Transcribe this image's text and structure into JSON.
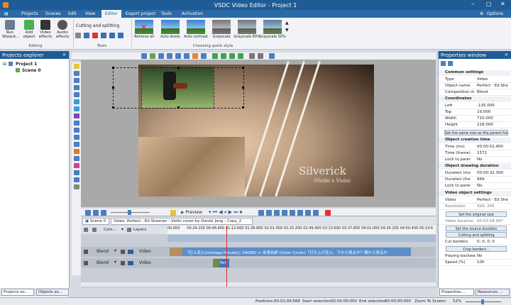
{
  "window": {
    "title": "VSDC Video Editor - Project 1",
    "options": "Options"
  },
  "menu": [
    "Projects",
    "Scenes",
    "Edit",
    "View",
    "Editor",
    "Export project",
    "Tools",
    "Activation"
  ],
  "ribbon": {
    "run_wizard": "Run Wizard...",
    "add_object": "Add object",
    "video_effects": "Video effects",
    "audio_effects": "Audio effects",
    "editing_group": "Editing",
    "cutting": "Cutting and splitting",
    "tools_group": "Tools",
    "quick_style_group": "Choosing quick style",
    "styles": [
      "Remove all",
      "Auto levels",
      "Auto contrast",
      "Grayscale",
      "Grayscale 80%",
      "Grayscale 50%"
    ]
  },
  "projects_explorer": {
    "title": "Projects explorer",
    "project": "Project 1",
    "scene": "Scene 0"
  },
  "bottom_tabs_left": [
    "Projects ex...",
    "Objects ex..."
  ],
  "watermark": {
    "line1": "Silverick",
    "line2": "(Violin x Viola)"
  },
  "timeline": {
    "preview_label": "Preview",
    "scene_tab": "Scene 0",
    "clip_tab": "Video: Perfect - Ed Sheeran - Violin cover by Daniel Jang - Copy_2",
    "header_com": "Com...",
    "header_layers": "Layers",
    "ticks": [
      "00.000",
      "00:24.200",
      "00:48.400",
      "01:12.600",
      "01:36.800",
      "02:01.000",
      "02:25.200",
      "02:49.400",
      "03:13.600",
      "03:37.800",
      "04:02.000",
      "04:26.200",
      "04:50.400",
      "05:14.6"
    ],
    "tracks": [
      {
        "blend": "Blend",
        "type": "Video",
        "clip": "『打上花火(Uchiage Hanabi)』DAOKO × 米津玄師 (Violin Cover)「打ち上げ花火、下から見るか？横から見るか"
      },
      {
        "blend": "Blend",
        "type": "Video",
        "clip": "Perf"
      }
    ]
  },
  "status": {
    "positions_label": "Positions:",
    "positions": "00:01:09:566",
    "start_sel_label": "Start selection:",
    "start_sel": "00:00:00:000",
    "end_sel_label": "End selection:",
    "end_sel": "00:00:00:000",
    "zoom": "Zoom To Screen",
    "zoom_pct": "52%"
  },
  "properties": {
    "title": "Properties window",
    "common": "Common settings",
    "type_k": "Type",
    "type_v": "Video",
    "name_k": "Object name",
    "name_v": "Perfect - Ed She",
    "comp_k": "Composition m",
    "comp_v": "Blend",
    "coords": "Coordinates",
    "left_k": "Left",
    "left_v": "-135.000",
    "top_k": "Top",
    "top_v": "19.000",
    "width_k": "Width",
    "width_v": "710.000",
    "height_k": "Height",
    "height_v": "218.000",
    "same_size": "Set the same size as the parent fra",
    "creation": "Object creation time",
    "tms_k": "Time (ms)",
    "tms_v": "00:00:52.400",
    "tfr_k": "Time (frame)",
    "tfr_v": "1572",
    "lock1_k": "Lock to parer",
    "lock1_v": "No",
    "drawing": "Object drawing duration",
    "dms_k": "Duration (ms",
    "dms_v": "00:00:32.300",
    "dfr_k": "Duration (fra",
    "dfr_v": "969",
    "lock2_k": "Lock to parer",
    "lock2_v": "No",
    "vos": "Video object settings",
    "video_k": "Video",
    "video_v": "Perfect - Ed She",
    "res_k": "Resolution",
    "res_v": "426; 240",
    "orig_size": "Set the original size",
    "vdur_k": "Video duration",
    "vdur_v": "00:03:58.947",
    "src_dur": "Set the source duration",
    "cut_split": "Cutting and splitting",
    "cut_k": "Cut borders",
    "cut_v": "0; 0; 0; 0",
    "crop": "Crop borders...",
    "back_k": "Playing backwa",
    "back_v": "No",
    "speed_k": "Speed (%)",
    "speed_v": "100"
  },
  "bottom_tabs_right": [
    "Properties ...",
    "Resources ..."
  ],
  "colors": {
    "accent": "#1f5c96",
    "playhead": "#e32424"
  }
}
